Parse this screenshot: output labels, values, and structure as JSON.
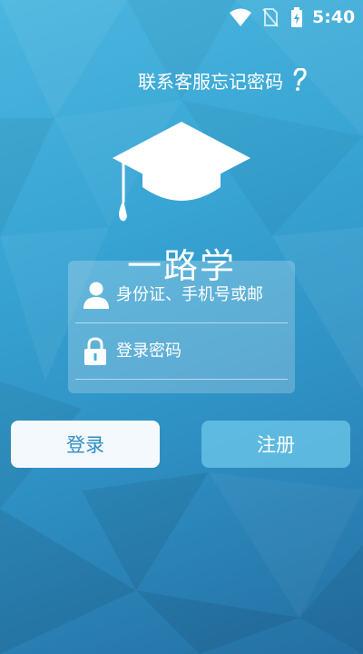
{
  "status_bar": {
    "time": "5:40",
    "icons": [
      "wifi-icon",
      "no-sim-icon",
      "battery-charging-icon"
    ]
  },
  "top_links": {
    "contact_support": "联系客服",
    "forgot_password": "忘记密码",
    "help_icon": "question-mark-icon"
  },
  "logo": {
    "icon": "graduation-cap-icon"
  },
  "app_title": "一路学",
  "login_form": {
    "account_placeholder": "身份证、手机号或邮",
    "account_icon": "user-icon",
    "password_placeholder": "登录密码",
    "password_icon": "lock-icon"
  },
  "buttons": {
    "login": "登录",
    "register": "注册"
  },
  "colors": {
    "background_top": "#4bb6df",
    "background_bottom": "#246fa3",
    "login_button_bg": "#f3f9fc",
    "login_button_text": "#2f8fc4",
    "register_button_bg": "#6ec8eb"
  }
}
